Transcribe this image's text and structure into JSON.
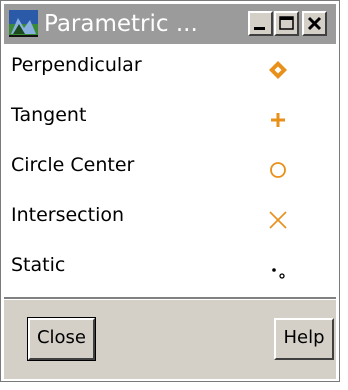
{
  "window": {
    "title": "Parametric ..."
  },
  "snap_options": [
    {
      "label": "Perpendicular",
      "icon": "diamond-snap-icon"
    },
    {
      "label": "Tangent",
      "icon": "plus-snap-icon"
    },
    {
      "label": "Circle Center",
      "icon": "circle-snap-icon"
    },
    {
      "label": "Intersection",
      "icon": "x-snap-icon"
    },
    {
      "label": "Static",
      "icon": "static-snap-icon"
    }
  ],
  "buttons": {
    "close_label": "Close",
    "help_label": "Help"
  },
  "colors": {
    "titlebar": "#9b9b9b",
    "snap_icon": "#e8901a",
    "dialog_face": "#d4d0c8"
  }
}
